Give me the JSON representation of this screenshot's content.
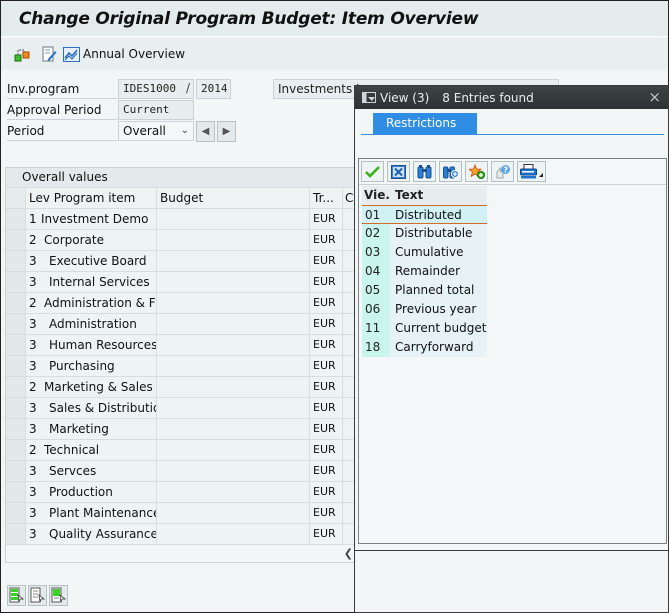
{
  "window": {
    "title": "Change Original Program Budget: Item Overview"
  },
  "toolbar": {
    "icons": [
      "hierarchy-icon",
      "edit-icon",
      "chart-icon"
    ],
    "annual_overview_label": "Annual Overview"
  },
  "header_fields": {
    "inv_program_label": "Inv.program",
    "inv_program_value": "IDES1000",
    "separator": "/",
    "year_value": "2014",
    "description_value": "Investments I",
    "approval_period_label": "Approval Period",
    "approval_period_value": "Current",
    "period_label": "Period",
    "period_value": "Overall"
  },
  "grid": {
    "title": "Overall values",
    "columns": [
      "Lev Program item",
      "Budget",
      "Tr...",
      "Cu"
    ],
    "rows": [
      {
        "lev": "1",
        "item": "Investment Demo",
        "budget": "",
        "currency": "EUR",
        "indent": 0
      },
      {
        "lev": "2",
        "item": "Corporate",
        "budget": "",
        "currency": "EUR",
        "indent": 1
      },
      {
        "lev": "3",
        "item": "Executive Board",
        "budget": "",
        "currency": "EUR",
        "indent": 2
      },
      {
        "lev": "3",
        "item": "Internal Services",
        "budget": "",
        "currency": "EUR",
        "indent": 2
      },
      {
        "lev": "2",
        "item": "Administration & Fi...",
        "budget": "",
        "currency": "EUR",
        "indent": 1
      },
      {
        "lev": "3",
        "item": "Administration",
        "budget": "",
        "currency": "EUR",
        "indent": 2
      },
      {
        "lev": "3",
        "item": "Human Resources",
        "budget": "",
        "currency": "EUR",
        "indent": 2
      },
      {
        "lev": "3",
        "item": "Purchasing",
        "budget": "",
        "currency": "EUR",
        "indent": 2
      },
      {
        "lev": "2",
        "item": "Marketing & Sales",
        "budget": "",
        "currency": "EUR",
        "indent": 1
      },
      {
        "lev": "3",
        "item": "Sales & Distribution",
        "budget": "",
        "currency": "EUR",
        "indent": 2
      },
      {
        "lev": "3",
        "item": "Marketing",
        "budget": "",
        "currency": "EUR",
        "indent": 2
      },
      {
        "lev": "2",
        "item": "Technical",
        "budget": "",
        "currency": "EUR",
        "indent": 1
      },
      {
        "lev": "3",
        "item": "Servces",
        "budget": "",
        "currency": "EUR",
        "indent": 2
      },
      {
        "lev": "3",
        "item": "Production",
        "budget": "",
        "currency": "EUR",
        "indent": 2
      },
      {
        "lev": "3",
        "item": "Plant Maintenance",
        "budget": "",
        "currency": "EUR",
        "indent": 2
      },
      {
        "lev": "3",
        "item": "Quality Assurance",
        "budget": "",
        "currency": "EUR",
        "indent": 2
      }
    ]
  },
  "popup": {
    "title": "View (3)",
    "entries_found": "8 Entries found",
    "close_icon": "×",
    "tab_label": "Restrictions",
    "toolbar_icons": [
      "checkmark-icon",
      "cancel-icon",
      "find-icon",
      "find-next-icon",
      "add-favorite-icon",
      "help-icon",
      "print-icon"
    ],
    "list_header": {
      "code": "Vie...",
      "text": "Text"
    },
    "list": [
      {
        "code": "01",
        "text": "Distributed",
        "selected": true
      },
      {
        "code": "02",
        "text": "Distributable"
      },
      {
        "code": "03",
        "text": "Cumulative"
      },
      {
        "code": "04",
        "text": "Remainder"
      },
      {
        "code": "05",
        "text": "Planned total"
      },
      {
        "code": "06",
        "text": "Previous year"
      },
      {
        "code": "11",
        "text": "Current budget"
      },
      {
        "code": "18",
        "text": "Carryforward"
      }
    ]
  },
  "colors": {
    "accent": "#2f8de4",
    "selection_border": "#d46a2a",
    "popup_title_bg": "#2c3133"
  }
}
